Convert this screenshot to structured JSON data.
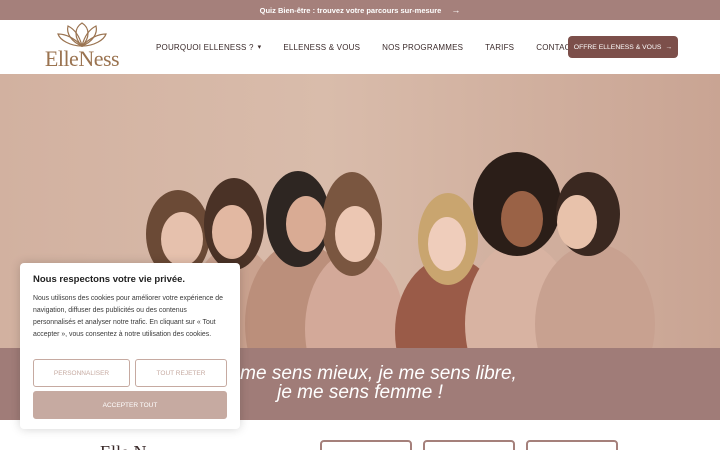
{
  "announcement": {
    "text": "Quiz Bien-être : trouvez votre parcours sur-mesure",
    "arrow": "→"
  },
  "logo": {
    "text": "ElleNess",
    "icon": "lotus-flower-icon"
  },
  "nav": {
    "items": [
      {
        "label": "POURQUOI ELLENESS ?",
        "caret": "▾"
      },
      {
        "label": "ELLENESS & VOUS"
      },
      {
        "label": "NOS PROGRAMMES"
      },
      {
        "label": "TARIFS"
      },
      {
        "label": "CONTACT"
      }
    ],
    "cta": {
      "label": "OFFRE ELLENESS & VOUS",
      "arrow": "→"
    }
  },
  "tagline": {
    "line1": "…me sens mieux, je me sens libre,",
    "line2": "je me sens femme !"
  },
  "cookie": {
    "title": "Nous respectons votre vie privée.",
    "body": "Nous utilisons des cookies pour améliorer votre expérience de navigation, diffuser des publicités ou des contenus personnalisés et analyser notre trafic. En cliquant sur « Tout accepter », vous consentez à notre utilisation des cookies.",
    "customize": "PERSONNALISER",
    "reject": "TOUT REJETER",
    "accept": "ACCEPTER TOUT"
  },
  "footer_logo": "Elle N",
  "colors": {
    "brand": "#a5807b",
    "cta": "#7c4f4a",
    "accent_light": "#c6aaa1",
    "logo_gold": "#9a7350"
  }
}
